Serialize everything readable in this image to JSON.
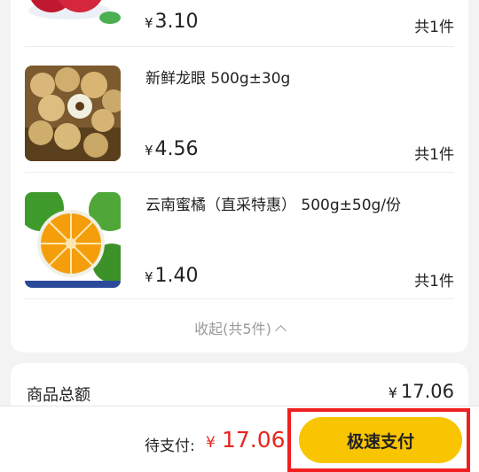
{
  "items": [
    {
      "name": "",
      "price_symbol": "¥",
      "price": "3.10",
      "qty": "共1件",
      "thumb_icon": "pomegranate-image"
    },
    {
      "name": "新鲜龙眼 500g±30g",
      "price_symbol": "¥",
      "price": "4.56",
      "qty": "共1件",
      "thumb_icon": "longan-image"
    },
    {
      "name": "云南蜜橘（直采特惠） 500g±50g/份",
      "price_symbol": "¥",
      "price": "1.40",
      "qty": "共1件",
      "thumb_icon": "orange-image"
    }
  ],
  "collapse": {
    "label": "收起(共5件)",
    "icon": "chevron-up-icon"
  },
  "summary": {
    "label": "商品总额",
    "symbol": "¥",
    "amount": "17.06"
  },
  "pay": {
    "label": "待支付:",
    "symbol": "¥",
    "amount": "17.06",
    "button": "极速支付"
  },
  "colors": {
    "accent": "#f9c400",
    "price_red": "#e5271f",
    "highlight": "#f01f1f"
  }
}
